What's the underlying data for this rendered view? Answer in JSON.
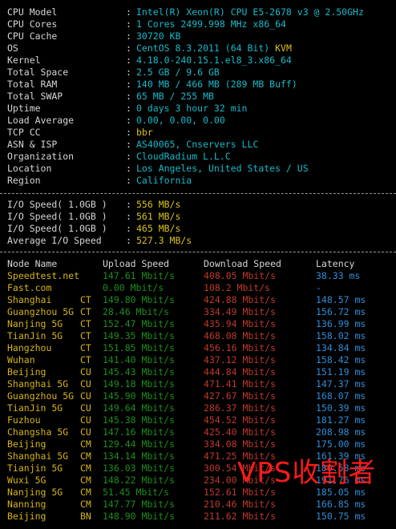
{
  "system_info": [
    {
      "label": "CPU Model",
      "value": "Intel(R) Xeon(R) CPU E5-2678 v3 @ 2.50GHz"
    },
    {
      "label": "CPU Cores",
      "value": "1 Cores 2499.998 MHz x86_64"
    },
    {
      "label": "CPU Cache",
      "value": "30720 KB"
    },
    {
      "label": "OS",
      "value": "CentOS 8.3.2011 (64 Bit) KVM"
    },
    {
      "label": "Kernel",
      "value": "4.18.0-240.15.1.el8_3.x86_64"
    },
    {
      "label": "Total Space",
      "value": "2.5 GB / 9.6 GB"
    },
    {
      "label": "Total RAM",
      "value": "140 MB / 466 MB (289 MB Buff)"
    },
    {
      "label": "Total SWAP",
      "value": "65 MB / 255 MB"
    },
    {
      "label": "Uptime",
      "value": "0 days 3 hour 32 min"
    },
    {
      "label": "Load Average",
      "value": "0.00, 0.00, 0.00"
    },
    {
      "label": "TCP CC",
      "value": "bbr"
    },
    {
      "label": "ASN & ISP",
      "value": "AS40065, Cnservers LLC"
    },
    {
      "label": "Organization",
      "value": "CloudRadium L.L.C"
    },
    {
      "label": "Location",
      "value": "Los Angeles, United States / US"
    },
    {
      "label": "Region",
      "value": "California"
    }
  ],
  "io_tests": [
    {
      "label": "I/O Speed( 1.0GB )",
      "value": "556 MB/s"
    },
    {
      "label": "I/O Speed( 1.0GB )",
      "value": "561 MB/s"
    },
    {
      "label": "I/O Speed( 1.0GB )",
      "value": "465 MB/s"
    },
    {
      "label": "Average I/O Speed",
      "value": "527.3 MB/s"
    }
  ],
  "speed_table": {
    "headers": {
      "node": "Node Name",
      "upload": "Upload Speed",
      "download": "Download Speed",
      "latency": "Latency"
    },
    "rows": [
      {
        "node": "Speedtest.net",
        "isp": "",
        "upload": "147.61 Mbit/s",
        "download": "408.05 Mbit/s",
        "latency": "38.33 ms",
        "style": "first"
      },
      {
        "node": "Fast.com",
        "isp": "",
        "upload": "0.00 Mbit/s",
        "download": "108.2 Mbit/s",
        "latency": "-",
        "style": "first"
      },
      {
        "node": "Shanghai",
        "isp": "CT",
        "upload": "149.80 Mbit/s",
        "download": "424.88 Mbit/s",
        "latency": "148.57 ms"
      },
      {
        "node": "Guangzhou 5G",
        "isp": "CT",
        "upload": "28.46 Mbit/s",
        "download": "334.49 Mbit/s",
        "latency": "156.72 ms"
      },
      {
        "node": "Nanjing 5G",
        "isp": "CT",
        "upload": "152.47 Mbit/s",
        "download": "435.94 Mbit/s",
        "latency": "136.99 ms"
      },
      {
        "node": "TianJin 5G",
        "isp": "CT",
        "upload": "149.35 Mbit/s",
        "download": "468.08 Mbit/s",
        "latency": "158.02 ms"
      },
      {
        "node": "Hangzhou",
        "isp": "CT",
        "upload": "151.85 Mbit/s",
        "download": "456.16 Mbit/s",
        "latency": "134.84 ms"
      },
      {
        "node": "Wuhan",
        "isp": "CT",
        "upload": "141.40 Mbit/s",
        "download": "437.12 Mbit/s",
        "latency": "158.42 ms"
      },
      {
        "node": "Beijing",
        "isp": "CU",
        "upload": "145.43 Mbit/s",
        "download": "444.84 Mbit/s",
        "latency": "151.19 ms"
      },
      {
        "node": "Shanghai 5G",
        "isp": "CU",
        "upload": "149.18 Mbit/s",
        "download": "471.41 Mbit/s",
        "latency": "147.37 ms"
      },
      {
        "node": "Guangzhou 5G",
        "isp": "CU",
        "upload": "145.90 Mbit/s",
        "download": "427.67 Mbit/s",
        "latency": "168.07 ms"
      },
      {
        "node": "TianJin 5G",
        "isp": "CU",
        "upload": "149.64 Mbit/s",
        "download": "286.37 Mbit/s",
        "latency": "150.39 ms"
      },
      {
        "node": "Fuzhou",
        "isp": "CU",
        "upload": "145.38 Mbit/s",
        "download": "454.52 Mbit/s",
        "latency": "181.27 ms"
      },
      {
        "node": "Changsha 5G",
        "isp": "CU",
        "upload": "147.16 Mbit/s",
        "download": "425.40 Mbit/s",
        "latency": "208.98 ms"
      },
      {
        "node": "Beijing",
        "isp": "CM",
        "upload": "129.44 Mbit/s",
        "download": "334.08 Mbit/s",
        "latency": "175.00 ms"
      },
      {
        "node": "Shanghai 5G",
        "isp": "CM",
        "upload": "134.14 Mbit/s",
        "download": "471.25 Mbit/s",
        "latency": "161.39 ms"
      },
      {
        "node": "Tianjin 5G",
        "isp": "CM",
        "upload": "136.03 Mbit/s",
        "download": "300.54 Mbit/s",
        "latency": "180.58 ms"
      },
      {
        "node": "Wuxi 5G",
        "isp": "CM",
        "upload": "148.22 Mbit/s",
        "download": "234.00 Mbit/s",
        "latency": "191.76 ms"
      },
      {
        "node": "Nanjing 5G",
        "isp": "CM",
        "upload": "51.45 Mbit/s",
        "download": "152.61 Mbit/s",
        "latency": "185.05 ms"
      },
      {
        "node": "Nanning",
        "isp": "CM",
        "upload": "147.77 Mbit/s",
        "download": "210.46 Mbit/s",
        "latency": "166.85 ms"
      },
      {
        "node": "Beijing",
        "isp": "BN",
        "upload": "148.90 Mbit/s",
        "download": "211.62 Mbit/s",
        "latency": "150.75 ms"
      }
    ]
  },
  "watermark": "VPS收割者",
  "colors": {
    "value_cyan": "#19b9c9",
    "highlight_yellow": "#d8c21a",
    "upload_green": "#1fa21f",
    "download_red": "#c0392b",
    "latency_blue": "#2d8ed8",
    "node_gold": "#d6b415",
    "watermark_red": "#ff1a1a"
  }
}
